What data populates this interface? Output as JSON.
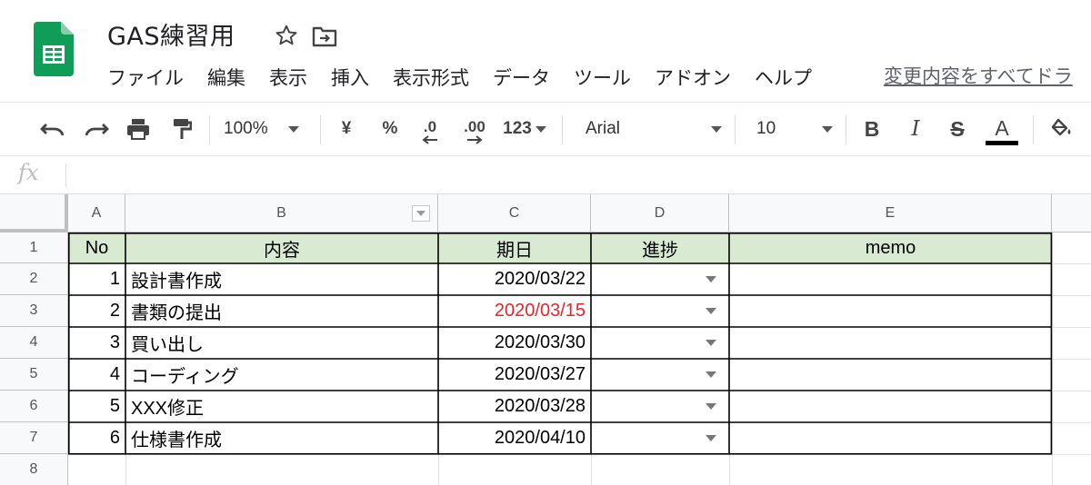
{
  "doc": {
    "title": "GAS練習用",
    "last_edit": "変更内容をすべてドラ"
  },
  "menu": [
    "ファイル",
    "編集",
    "表示",
    "挿入",
    "表示形式",
    "データ",
    "ツール",
    "アドオン",
    "ヘルプ"
  ],
  "toolbar": {
    "zoom": "100%",
    "currency": "¥",
    "percent": "%",
    "decrease_decimal": ".0",
    "increase_decimal": ".00",
    "more_formats": "123",
    "font": "Arial",
    "font_size": "10",
    "bold": "B",
    "italic": "I",
    "strikethrough": "S",
    "text_color": "A"
  },
  "formula_bar": {
    "label": "fx",
    "value": ""
  },
  "columns": [
    "A",
    "B",
    "C",
    "D",
    "E"
  ],
  "row_numbers": [
    "1",
    "2",
    "3",
    "4",
    "5",
    "6",
    "7",
    "8"
  ],
  "table": {
    "headers": [
      "No",
      "内容",
      "期日",
      "進捗",
      "memo"
    ],
    "rows": [
      {
        "no": "1",
        "content": "設計書作成",
        "date": "2020/03/22",
        "progress": "",
        "memo": "",
        "overdue": false
      },
      {
        "no": "2",
        "content": "書類の提出",
        "date": "2020/03/15",
        "progress": "",
        "memo": "",
        "overdue": true
      },
      {
        "no": "3",
        "content": "買い出し",
        "date": "2020/03/30",
        "progress": "",
        "memo": "",
        "overdue": false
      },
      {
        "no": "4",
        "content": "コーディング",
        "date": "2020/03/27",
        "progress": "",
        "memo": "",
        "overdue": false
      },
      {
        "no": "5",
        "content": "XXX修正",
        "date": "2020/03/28",
        "progress": "",
        "memo": "",
        "overdue": false
      },
      {
        "no": "6",
        "content": "仕様書作成",
        "date": "2020/04/10",
        "progress": "",
        "memo": "",
        "overdue": false
      }
    ]
  },
  "colors": {
    "header_fill": "#d9ead3",
    "overdue_text": "#e8232b",
    "logo_green": "#0f9d58"
  }
}
